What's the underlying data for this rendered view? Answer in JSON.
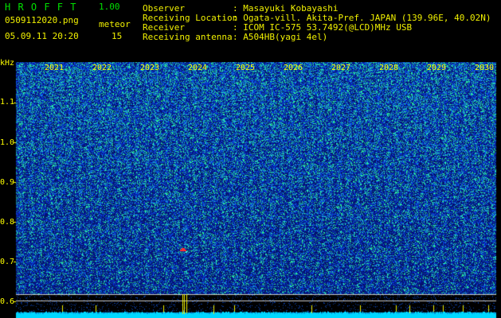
{
  "app": {
    "title": "H R O F F T",
    "version": "1.00",
    "filename": "0509112020.png",
    "timestamp": "05.09.11 20:20",
    "meteor_label": "meteor",
    "meteor_count": "15"
  },
  "info": {
    "rows": [
      {
        "label": "Observer",
        "value": ": Masayuki Kobayashi"
      },
      {
        "label": "Receiving Location",
        "value": ": Ogata-vill. Akita-Pref. JAPAN (139.96E, 40.02N)"
      },
      {
        "label": "Receiver",
        "value": ": ICOM IC-575 53.7492(@LCD)MHz USB"
      },
      {
        "label": "Receiving antenna",
        "value": ": A504HB(yagi 4el)"
      }
    ]
  },
  "axis": {
    "unit": "kHz",
    "y_ticks": [
      "1.1",
      "1.0",
      "0.9",
      "0.8",
      "0.7",
      "0.6"
    ],
    "x_ticks": [
      "2021",
      "2022",
      "2023",
      "2024",
      "2025",
      "2026",
      "2027",
      "2028",
      "2029",
      "2030"
    ]
  },
  "colors": {
    "background": "#000000",
    "header_yellow": "#f0f000",
    "header_green": "#00e000",
    "spectrum_base": "#0a1a8c"
  }
}
